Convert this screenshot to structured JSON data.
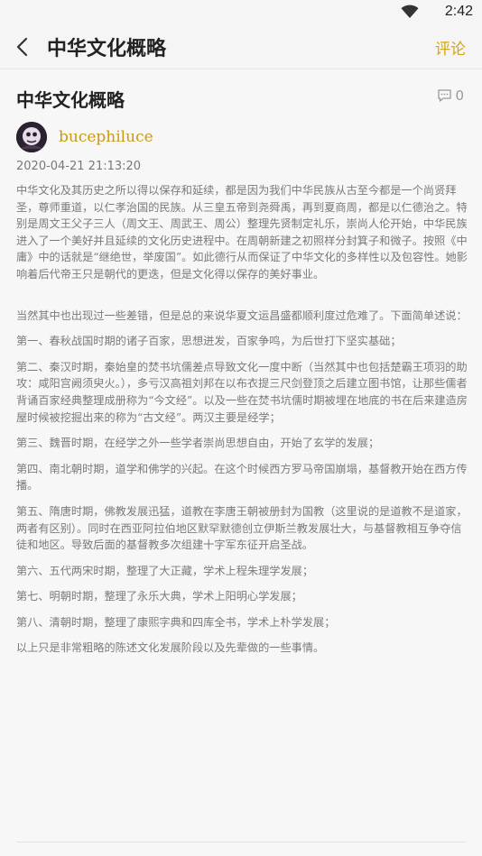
{
  "status_bar": {
    "time": "2:42"
  },
  "app_bar": {
    "title": "中华文化概略",
    "comment_link": "评论"
  },
  "article": {
    "title": "中华文化概略",
    "comment_count": "0",
    "author": "bucephiluce",
    "date": "2020-04-21 21:13:20",
    "paragraphs": [
      "中华文化及其历史之所以得以保存和延续，都是因为我们中华民族从古至今都是一个尚贤拜圣，尊师重道，以仁孝治国的民族。从三皇五帝到尧舜禹，再到夏商周，都是以仁德治之。特别是周文王父子三人（周文王、周武王、周公）整理先贤制定礼乐，崇尚人伦开始，中华民族进入了一个美好并且延续的文化历史进程中。在周朝新建之初照样分封箕子和微子。按照《中庸》中的话就是“继绝世，举废国”。如此德行从而保证了中华文化的多样性以及包容性。她影响着后代帝王只是朝代的更迭，但是文化得以保存的美好事业。",
      "当然其中也出现过一些差错，但是总的来说华夏文运昌盛都顺利度过危难了。下面简单述说：",
      "第一、春秋战国时期的诸子百家，思想迸发，百家争鸣，为后世打下坚实基础；",
      "第二、秦汉时期，秦始皇的焚书坑儒差点导致文化一度中断（当然其中也包括楚霸王项羽的助攻：咸阳宫阙须臾火。），多亏汉高祖刘邦在以布衣提三尺剑登顶之后建立图书馆，让那些儒者背诵百家经典整理成册称为“今文经”。以及一些在焚书坑儒时期被埋在地底的书在后来建造房屋时候被挖掘出来的称为“古文经”。两汉主要是经学；",
      "第三、魏晋时期，在经学之外一些学者崇尚思想自由，开始了玄学的发展；",
      "第四、南北朝时期，道学和佛学的兴起。在这个时候西方罗马帝国崩塌，基督教开始在西方传播。",
      "第五、隋唐时期，佛教发展迅猛，道教在李唐王朝被册封为国教（这里说的是道教不是道家，两者有区别）。同时在西亚阿拉伯地区默罕默德创立伊斯兰教发展壮大，与基督教相互争夺信徒和地区。导致后面的基督教多次组建十字军东征开启圣战。",
      "第六、五代两宋时期，整理了大正藏，学术上程朱理学发展；",
      "第七、明朝时期，整理了永乐大典，学术上阳明心学发展；",
      "第八、清朝时期，整理了康熙字典和四库全书，学术上朴学发展；",
      "以上只是非常粗略的陈述文化发展阶段以及先辈做的一些事情。"
    ]
  },
  "colors": {
    "accent": "#d4a514",
    "author": "#c99a10",
    "body_text": "#7a7a7a"
  },
  "icons": {
    "back": "chevron-left-icon",
    "comment": "comment-bubble-icon",
    "wifi": "wifi-icon"
  }
}
